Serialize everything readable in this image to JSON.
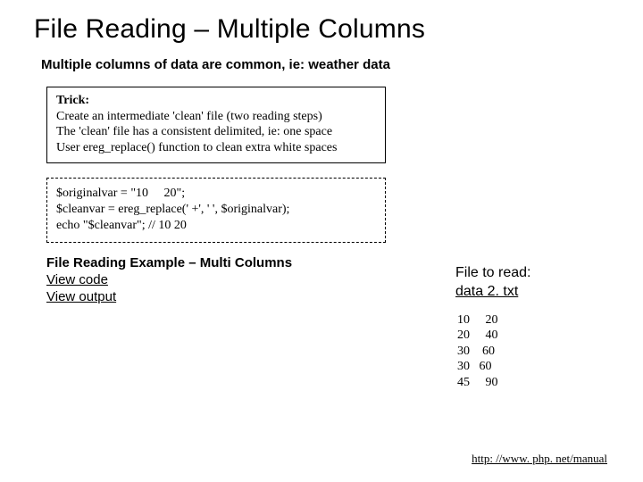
{
  "title": "File Reading – Multiple Columns",
  "subtitle": "Multiple columns of data are common, ie: weather data",
  "trick": {
    "label": "Trick:",
    "lines": [
      "Create an intermediate 'clean' file (two reading steps)",
      "The 'clean' file has a consistent delimited, ie: one space",
      "User ereg_replace() function to clean extra white spaces"
    ]
  },
  "code": "$originalvar = \"10     20\";\n$cleanvar = ereg_replace(' +', ' ', $originalvar);\necho \"$cleanvar\"; // 10 20",
  "example": {
    "heading": "File Reading Example – Multi Columns",
    "view_code": "View code",
    "view_output": "View output"
  },
  "file": {
    "label": "File to read:",
    "name": "data 2. txt",
    "contents": "10     20\n20     40\n30    60\n30   60\n45     90"
  },
  "footer_url": "http: //www. php. net/manual"
}
